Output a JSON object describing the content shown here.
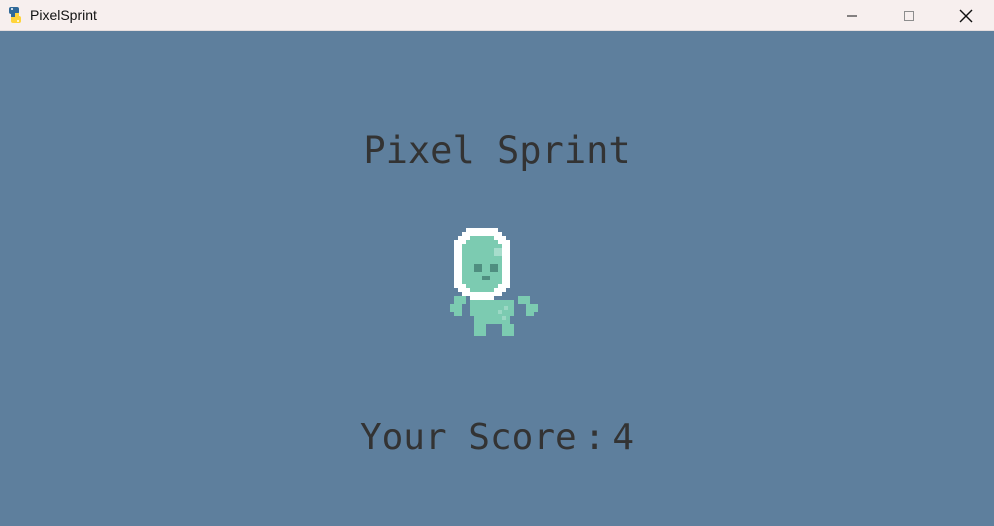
{
  "window": {
    "title": "PixelSprint",
    "app_icon": "python-snake-icon",
    "controls": [
      "minimize-icon",
      "maximize-icon",
      "close-icon"
    ]
  },
  "game": {
    "title": "Pixel Sprint",
    "score_label": "Your Score",
    "score_separator": ":",
    "score_value": "4",
    "background_color": "#5e7f9d",
    "text_color": "#333333",
    "character": {
      "icon": "astronaut-alien-sprite",
      "body_color": "#7ccbb1",
      "helmet_color": "#ffffff"
    }
  }
}
